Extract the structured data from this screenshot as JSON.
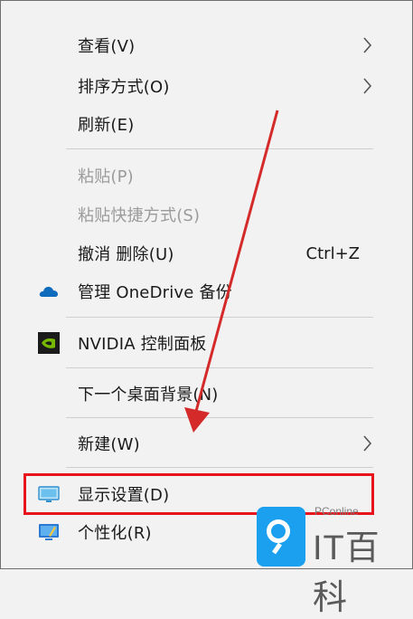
{
  "menu": {
    "items": [
      {
        "label": "查看(V)",
        "submenu": true
      },
      {
        "label": "排序方式(O)",
        "submenu": true
      },
      {
        "label": "刷新(E)"
      },
      {
        "label": "粘贴(P)",
        "disabled": true
      },
      {
        "label": "粘贴快捷方式(S)",
        "disabled": true
      },
      {
        "label": "撤消 删除(U)",
        "shortcut": "Ctrl+Z"
      },
      {
        "label": "管理 OneDrive 备份",
        "icon": "onedrive-cloud-icon"
      },
      {
        "label": "NVIDIA 控制面板",
        "icon": "nvidia-icon"
      },
      {
        "label": "下一个桌面背景(N)"
      },
      {
        "label": "新建(W)",
        "submenu": true
      },
      {
        "label": "显示设置(D)",
        "icon": "display-monitor-icon",
        "highlighted": true
      },
      {
        "label": "个性化(R)",
        "icon": "personalize-icon"
      }
    ]
  },
  "annotation": {
    "highlight_color": "#e8141c",
    "arrow_color": "#d42a2a"
  },
  "watermark": {
    "top_text": "PConline",
    "main_text": "IT百科",
    "brand_color": "#1aa0ee"
  }
}
